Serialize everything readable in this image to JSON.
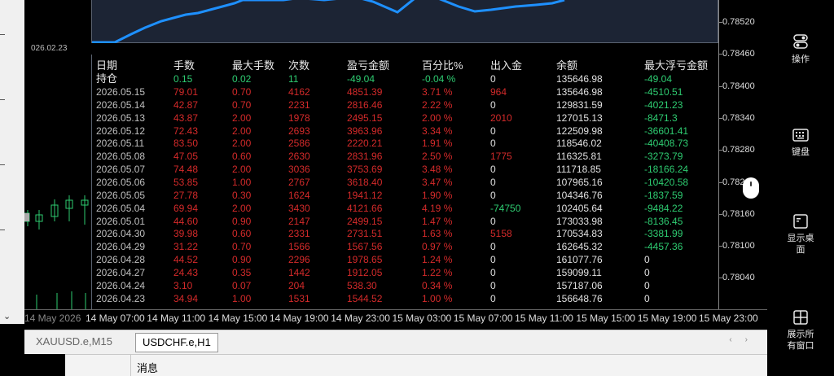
{
  "stats": {
    "headers": [
      "日期",
      "手数",
      "最大手数",
      "次数",
      "盈亏金额",
      "百分比%",
      "出入金",
      "余额",
      "最大浮亏金额"
    ],
    "holding": [
      "持仓",
      "0.15",
      "0.02",
      "11",
      "-49.04",
      "-0.04 %",
      "0",
      "135646.98",
      "-49.04"
    ],
    "rows": [
      [
        "2026.05.15",
        "79.01",
        "0.70",
        "4162",
        "4851.39",
        "3.71 %",
        "964",
        "135646.98",
        "-4510.51"
      ],
      [
        "2026.05.14",
        "42.87",
        "0.70",
        "2231",
        "2816.46",
        "2.22 %",
        "0",
        "129831.59",
        "-4021.23"
      ],
      [
        "2026.05.13",
        "43.87",
        "2.00",
        "1978",
        "2495.15",
        "2.00 %",
        "2010",
        "127015.13",
        "-8471.3"
      ],
      [
        "2026.05.12",
        "72.43",
        "2.00",
        "2693",
        "3963.96",
        "3.34 %",
        "0",
        "122509.98",
        "-36601.41"
      ],
      [
        "2026.05.11",
        "83.50",
        "2.00",
        "2586",
        "2220.21",
        "1.91 %",
        "0",
        "118546.02",
        "-40408.73"
      ],
      [
        "2026.05.08",
        "47.05",
        "0.60",
        "2630",
        "2831.96",
        "2.50 %",
        "1775",
        "116325.81",
        "-3273.79"
      ],
      [
        "2026.05.07",
        "74.48",
        "2.00",
        "3036",
        "3753.69",
        "3.48 %",
        "0",
        "111718.85",
        "-18166.24"
      ],
      [
        "2026.05.06",
        "53.85",
        "1.00",
        "2767",
        "3618.40",
        "3.47 %",
        "0",
        "107965.16",
        "-10420.58"
      ],
      [
        "2026.05.05",
        "27.78",
        "0.30",
        "1624",
        "1941.12",
        "1.90 %",
        "0",
        "104346.76",
        "-1837.59"
      ],
      [
        "2026.05.04",
        "69.94",
        "2.00",
        "3430",
        "4121.66",
        "4.19 %",
        "-74750",
        "102405.64",
        "-9484.22"
      ],
      [
        "2026.05.01",
        "44.60",
        "0.90",
        "2147",
        "2499.15",
        "1.47 %",
        "0",
        "173033.98",
        "-8136.45"
      ],
      [
        "2026.04.30",
        "39.98",
        "0.60",
        "2331",
        "2731.51",
        "1.63 %",
        "5158",
        "170534.83",
        "-3381.99"
      ],
      [
        "2026.04.29",
        "31.22",
        "0.70",
        "1566",
        "1567.56",
        "0.97 %",
        "0",
        "162645.32",
        "-4457.36"
      ],
      [
        "2026.04.28",
        "44.52",
        "0.90",
        "2296",
        "1978.65",
        "1.24 %",
        "0",
        "161077.76",
        "0"
      ],
      [
        "2026.04.27",
        "24.43",
        "0.35",
        "1442",
        "1912.05",
        "1.22 %",
        "0",
        "159099.11",
        "0"
      ],
      [
        "2026.04.24",
        "3.10",
        "0.07",
        "204",
        "538.30",
        "0.34 %",
        "0",
        "157187.06",
        "0"
      ],
      [
        "2026.04.23",
        "34.94",
        "1.00",
        "1531",
        "1544.52",
        "1.00 %",
        "0",
        "156648.76",
        "0"
      ]
    ],
    "equity_start_date": "026.02.23"
  },
  "price_axis": [
    "0.78520",
    "0.78460",
    "0.78400",
    "0.78340",
    "0.78280",
    "0.782",
    "0.78160",
    "0.78100",
    "0.78040"
  ],
  "time_axis": [
    "14 May 2026",
    "14 May 07:00",
    "14 May 11:00",
    "14 May 15:00",
    "14 May 19:00",
    "14 May 23:00",
    "15 May 03:00",
    "15 May 07:00",
    "15 May 11:00",
    "15 May 15:00",
    "15 May 19:00",
    "15 May 23:00"
  ],
  "tabs": [
    {
      "label": "XAUUSD.e,M15",
      "active": false
    },
    {
      "label": "USDCHF.e,H1",
      "active": true
    }
  ],
  "toolbox": {
    "label": "消息"
  },
  "sidebar": [
    {
      "label": "操作",
      "icon": "toggle-icon"
    },
    {
      "label": "键盘",
      "icon": "keyboard-icon"
    },
    {
      "label": "显示桌面",
      "icon": "desktop-icon"
    },
    {
      "label": "展示所有窗口",
      "icon": "windows-grid-icon"
    }
  ],
  "colors": {
    "profit": "#d42a2a",
    "loss": "#2ecc71",
    "equity_line": "#1e90ff",
    "panel_bg": "#1c2434"
  }
}
